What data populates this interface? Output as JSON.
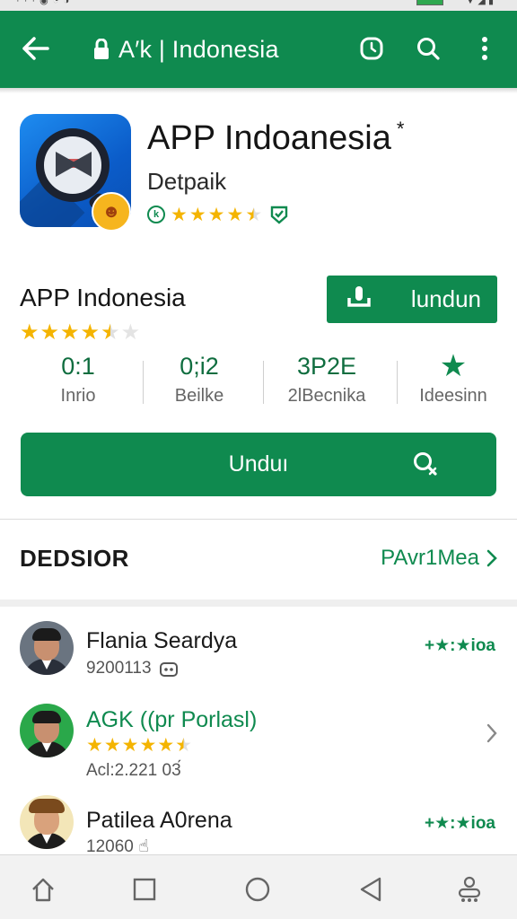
{
  "toolbar": {
    "title": "A′k | Indonesia"
  },
  "header": {
    "app_name": "APP Indoanesia",
    "asterisk": "*",
    "developer": "Detpaik",
    "badge_letter": "k",
    "rating_stars": 4.5
  },
  "summary": {
    "name": "APP Indonesia",
    "rating_stars": 4.5,
    "install_label": "lundun"
  },
  "stats": [
    {
      "value": "0:1",
      "label": "Inrio"
    },
    {
      "value": "0;i2",
      "label": "Beilke"
    },
    {
      "value": "3P2E",
      "label": "2lBecnika"
    },
    {
      "value": "★",
      "label": "Ideesinn"
    }
  ],
  "main_button": {
    "label": "Unduı"
  },
  "section": {
    "heading": "DEDSIOR",
    "link": "PAvr1Mea"
  },
  "reviews": [
    {
      "name": "Flania Seardya",
      "sub": "9200113",
      "badge": "+★:★ioa",
      "stars": null
    },
    {
      "name": "AGK ((pr Porlasl)",
      "sub": "Acl:2.221 03́",
      "badge": "",
      "stars": 5
    },
    {
      "name": "Patilea A0rena",
      "sub": "12060 ☝",
      "badge": "+★:★ioa",
      "stars": null
    }
  ],
  "colors": {
    "primary": "#0f8a4f",
    "star": "#f4b400"
  },
  "icons": {
    "toolbar": [
      "back-arrow-icon",
      "lock-icon",
      "timer-icon",
      "search-icon",
      "more-vert-icon"
    ],
    "nav": [
      "home-icon",
      "square-icon",
      "circle-icon",
      "back-triangle-icon",
      "accessibility-icon"
    ]
  }
}
